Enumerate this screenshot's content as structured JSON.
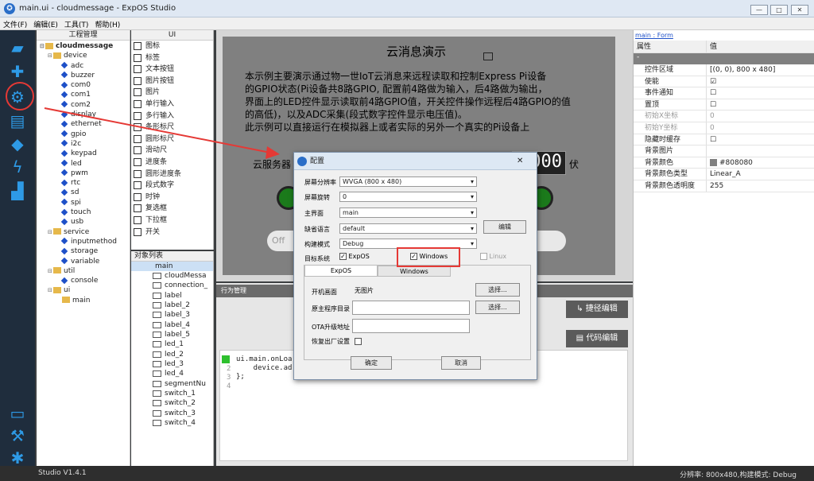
{
  "window": {
    "title": "main.ui - cloudmessage - ExpOS Studio",
    "controls": [
      "—",
      "□",
      "✕"
    ]
  },
  "menu": [
    "文件(F)",
    "编辑(E)",
    "工具(T)",
    "帮助(H)"
  ],
  "project": {
    "header": "工程管理",
    "root": "cloudmessage",
    "device": {
      "label": "device",
      "items": [
        "adc",
        "buzzer",
        "com0",
        "com1",
        "com2",
        "display",
        "ethernet",
        "gpio",
        "i2c",
        "keypad",
        "led",
        "pwm",
        "rtc",
        "sd",
        "spi",
        "touch",
        "usb"
      ]
    },
    "service": {
      "label": "service",
      "items": [
        "inputmethod",
        "storage",
        "variable"
      ]
    },
    "util": {
      "label": "util",
      "items": [
        "console"
      ]
    },
    "ui": {
      "label": "ui",
      "items": [
        "main"
      ]
    }
  },
  "ui_panel": {
    "header": "UI",
    "items": [
      "图标",
      "标签",
      "文本按钮",
      "图片按钮",
      "图片",
      "单行输入",
      "多行输入",
      "条形标尺",
      "圆形标尺",
      "滑动尺",
      "进度条",
      "圆形进度条",
      "段式数字",
      "时钟",
      "复选框",
      "下拉框",
      "开关"
    ]
  },
  "objects": {
    "header": "对象列表",
    "root": "main",
    "items": [
      "cloudMessa",
      "connection_",
      "label",
      "label_2",
      "label_3",
      "label_4",
      "label_5",
      "led_1",
      "led_2",
      "led_3",
      "led_4",
      "segmentNu",
      "switch_1",
      "switch_2",
      "switch_3",
      "switch_4"
    ]
  },
  "design": {
    "title": "云消息演示",
    "desc": [
      "本示例主要演示通过物一世IoT云消息来远程读取和控制Express Pi设备",
      "的GPIO状态(Pi设备共8路GPIO, 配置前4路做为输入，后4路做为输出，",
      "界面上的LED控件显示读取前4路GPIO值，开关控件操作远程后4路GPIO的值",
      "的高低)，以及ADC采集(段式数字控件显示电压值)。",
      "此示例可以直接运行在模拟器上或者实际的另外一个真实的Pi设备上"
    ],
    "server_label": "云服务器",
    "seg_value": "000",
    "unit": "伏",
    "off": "Off"
  },
  "behavior": {
    "title": "行为管理",
    "shortcut_btn": "捷径编辑",
    "code_btn": "代码编辑",
    "code": [
      "ui.main.onLoa",
      "    device.ad",
      "};"
    ],
    "lines": [
      "1",
      "2",
      "3",
      "4"
    ]
  },
  "props": {
    "link": "main : Form",
    "col_key": "属性",
    "col_val": "值",
    "section": "-",
    "rows": [
      [
        "控件区域",
        "[(0, 0), 800 x 480]"
      ],
      [
        "使能",
        "☑"
      ],
      [
        "事件通知",
        "☐"
      ],
      [
        "置顶",
        "☐"
      ],
      [
        "初始X坐标",
        "0"
      ],
      [
        "初始Y坐标",
        "0"
      ],
      [
        "隐藏时缓存",
        "☐"
      ],
      [
        "背景图片",
        ""
      ],
      [
        "背景颜色",
        "#808080"
      ],
      [
        "背景颜色类型",
        "Linear_A"
      ],
      [
        "背景颜色透明度",
        "255"
      ]
    ]
  },
  "dialog": {
    "title": "配置",
    "resolution_label": "屏幕分辨率",
    "resolution": "WVGA    (800 x 480)",
    "rotation_label": "屏幕旋转",
    "rotation": "0",
    "main_label": "主界面",
    "main": "main",
    "lang_label": "缺省语言",
    "lang": "default",
    "edit": "编辑",
    "build_label": "构建模式",
    "build": "Debug",
    "target_label": "目标系统",
    "target1": "ExpOS",
    "target2": "Windows",
    "target3": "Linux",
    "tab1": "ExpOS",
    "tab2": "Windows",
    "boot_label": "开机画面",
    "boot": "无图片",
    "choose": "选择...",
    "host_label": "原主程序目录",
    "ota_label": "OTA升级地址",
    "reset_label": "恢复出厂设置",
    "ok": "确定",
    "cancel": "取消"
  },
  "status": {
    "left": "Studio V1.4.1",
    "right": "分辨率: 800x480,构建模式: Debug"
  },
  "colors": {
    "accent": "#2e9ae6",
    "annot": "#e53935"
  }
}
